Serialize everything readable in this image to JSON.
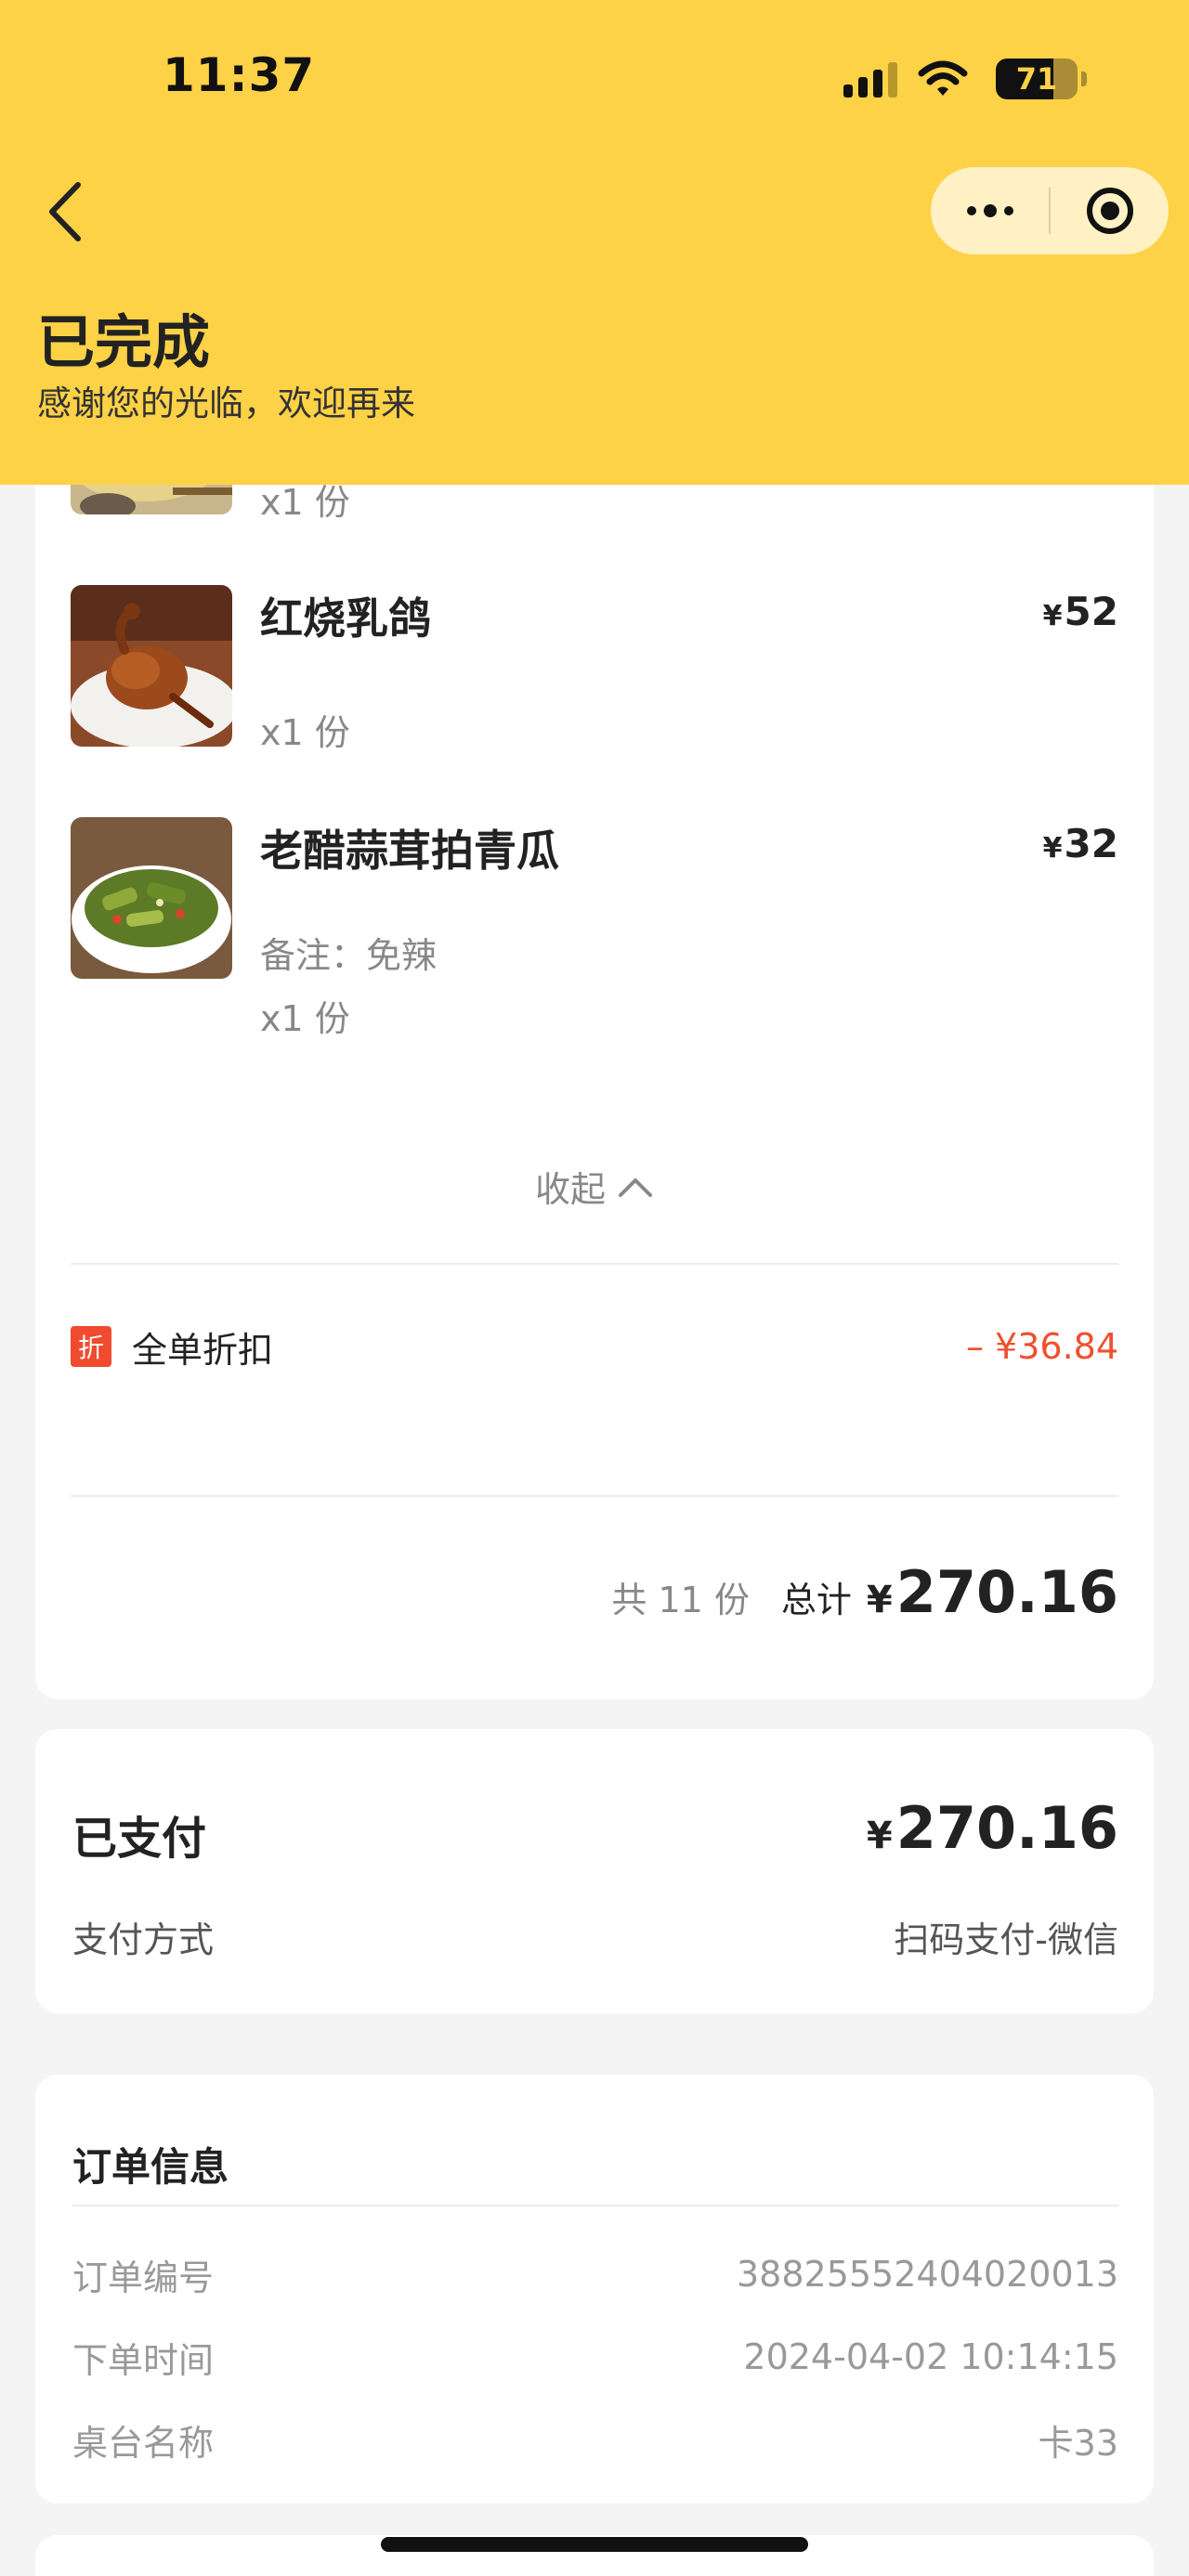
{
  "status_bar": {
    "time": "11:37",
    "battery": "71",
    "battery_level": 0.71
  },
  "nav": {
    "back_icon": "chevron-left-icon",
    "more_icon": "more-dots-icon",
    "target_icon": "target-icon"
  },
  "header": {
    "title": "已完成",
    "subtitle": "感谢您的光临，欢迎再来"
  },
  "items": [
    {
      "name": "",
      "qty": "x1 份",
      "price": ""
    },
    {
      "name": "红烧乳鸽",
      "yen": "¥",
      "price": "52",
      "qty": "x1 份"
    },
    {
      "name": "老醋蒜茸拍青瓜",
      "yen": "¥",
      "price": "32",
      "note": "备注：免辣",
      "qty": "x1 份"
    }
  ],
  "collapse": {
    "label": "收起",
    "icon": "chevron-up-icon"
  },
  "discount": {
    "tag": "折",
    "label": "全单折扣",
    "amount": "– ¥36.84"
  },
  "summary": {
    "count": "共 11 份",
    "total_label": "总计",
    "yen": "¥",
    "total": "270.16"
  },
  "payment": {
    "title": "已支付",
    "yen": "¥",
    "amount": "270.16",
    "method_label": "支付方式",
    "method_value": "扫码支付-微信"
  },
  "order_info": {
    "title": "订单信息",
    "rows": [
      {
        "label": "订单编号",
        "value": "38825552404020013"
      },
      {
        "label": "下单时间",
        "value": "2024-04-02 10:14:15"
      },
      {
        "label": "桌台名称",
        "value": "卡33"
      }
    ]
  },
  "colors": {
    "header_bg": "#fed247",
    "discount_red": "#f0502f",
    "tag_red": "#f04a2f"
  }
}
